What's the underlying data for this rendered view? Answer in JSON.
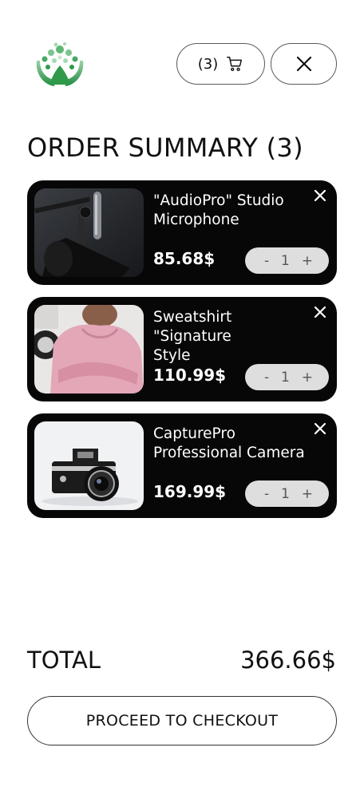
{
  "header": {
    "cart_count": "(3)",
    "icons": {
      "logo": "leaf-logo",
      "cart": "cart-icon",
      "close": "close-icon"
    }
  },
  "summary": {
    "title": "ORDER SUMMARY (3)"
  },
  "items": [
    {
      "name": "\"AudioPro\" Studio\nMicrophone",
      "price": "85.68$",
      "quantity": "1",
      "minus": "-",
      "plus": "+"
    },
    {
      "name": "Sweatshirt \"Signature\nStyle",
      "price": "110.99$",
      "quantity": "1",
      "minus": "-",
      "plus": "+"
    },
    {
      "name": "CapturePro\nProfessional Camera",
      "price": "169.99$",
      "quantity": "1",
      "minus": "-",
      "plus": "+"
    }
  ],
  "total": {
    "label": "TOTAL",
    "value": "366.66$"
  },
  "checkout": {
    "label": "PROCEED TO CHECKOUT"
  },
  "colors": {
    "card_bg": "#070707",
    "qty_bg": "#dedede",
    "logo_green": "#2f9a4a"
  }
}
